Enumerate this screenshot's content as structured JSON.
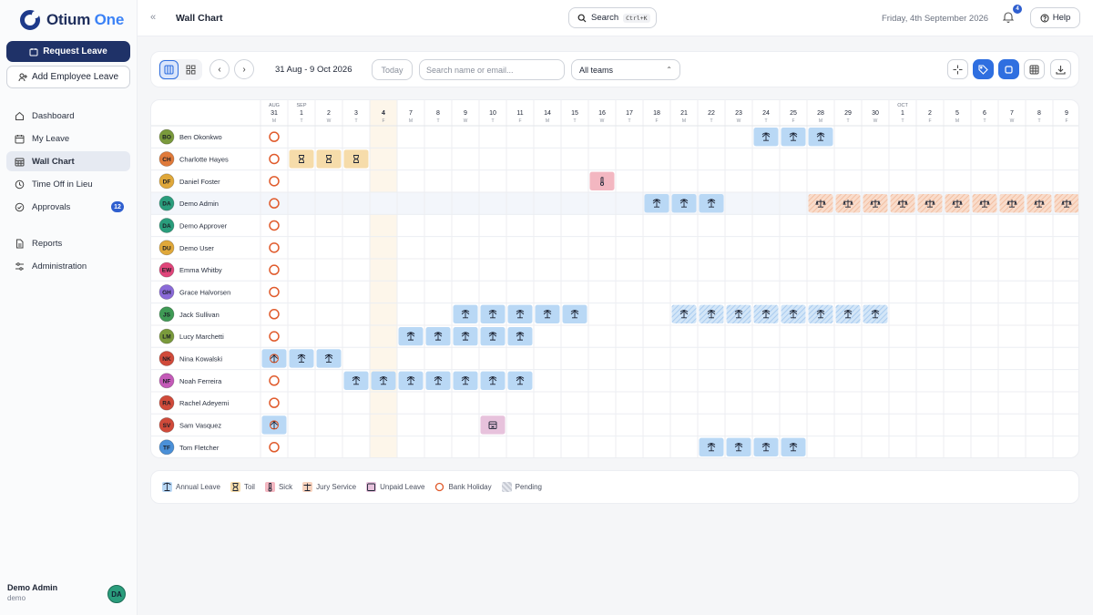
{
  "app": {
    "name_a": "Otium",
    "name_b": " One"
  },
  "sidebar": {
    "request_leave": "Request Leave",
    "add_employee_leave": "Add Employee Leave",
    "items": [
      {
        "label": "Dashboard",
        "icon": "home-icon"
      },
      {
        "label": "My Leave",
        "icon": "calendar-icon"
      },
      {
        "label": "Wall Chart",
        "icon": "calendar-grid-icon",
        "active": true
      },
      {
        "label": "Time Off in Lieu",
        "icon": "clock-icon"
      },
      {
        "label": "Approvals",
        "icon": "check-circle-icon",
        "badge": "12"
      },
      {
        "label": "Reports",
        "icon": "document-icon"
      },
      {
        "label": "Administration",
        "icon": "sliders-icon"
      }
    ],
    "user": {
      "name": "Demo Admin",
      "role": "demo",
      "initials": "DA"
    }
  },
  "topbar": {
    "title": "Wall Chart",
    "search_label": "Search",
    "search_shortcut": "Ctrl+K",
    "date": "Friday, 4th September 2026",
    "notifications": "4",
    "help": "Help"
  },
  "toolbar": {
    "range": "31 Aug - 9 Oct 2026",
    "today": "Today",
    "search_placeholder": "Search name or email...",
    "team": "All teams"
  },
  "days": [
    {
      "m": "AUG",
      "d": "31",
      "w": "M"
    },
    {
      "m": "SEP",
      "d": "1",
      "w": "T"
    },
    {
      "d": "2",
      "w": "W"
    },
    {
      "d": "3",
      "w": "T"
    },
    {
      "d": "4",
      "w": "F",
      "today": true
    },
    {
      "d": "7",
      "w": "M"
    },
    {
      "d": "8",
      "w": "T"
    },
    {
      "d": "9",
      "w": "W"
    },
    {
      "d": "10",
      "w": "T"
    },
    {
      "d": "11",
      "w": "F"
    },
    {
      "d": "14",
      "w": "M"
    },
    {
      "d": "15",
      "w": "T"
    },
    {
      "d": "16",
      "w": "W"
    },
    {
      "d": "17",
      "w": "T"
    },
    {
      "d": "18",
      "w": "F"
    },
    {
      "d": "21",
      "w": "M"
    },
    {
      "d": "22",
      "w": "T"
    },
    {
      "d": "23",
      "w": "W"
    },
    {
      "d": "24",
      "w": "T"
    },
    {
      "d": "25",
      "w": "F"
    },
    {
      "d": "28",
      "w": "M"
    },
    {
      "d": "29",
      "w": "T"
    },
    {
      "d": "30",
      "w": "W"
    },
    {
      "m": "OCT",
      "d": "1",
      "w": "T"
    },
    {
      "d": "2",
      "w": "F"
    },
    {
      "d": "5",
      "w": "M"
    },
    {
      "d": "6",
      "w": "T"
    },
    {
      "d": "7",
      "w": "W"
    },
    {
      "d": "8",
      "w": "T"
    },
    {
      "d": "9",
      "w": "F"
    }
  ],
  "employees": [
    {
      "initials": "BO",
      "name": "Ben Okonkwo",
      "color": "#7a9a3c",
      "leaves": [
        {
          "type": "annual",
          "days": [
            18,
            19,
            20
          ]
        }
      ]
    },
    {
      "initials": "CH",
      "name": "Charlotte Hayes",
      "color": "#e07a3a",
      "leaves": [
        {
          "type": "toil",
          "days": [
            1,
            2,
            3
          ]
        }
      ]
    },
    {
      "initials": "DF",
      "name": "Daniel Foster",
      "color": "#e0a83a",
      "leaves": [
        {
          "type": "sick",
          "days": [
            12
          ]
        }
      ]
    },
    {
      "initials": "DA",
      "name": "Demo Admin",
      "color": "#2a9d7c",
      "highlight": true,
      "leaves": [
        {
          "type": "annual",
          "days": [
            14,
            15,
            16
          ]
        },
        {
          "type": "jury",
          "days": [
            20,
            21,
            22,
            23,
            24,
            25,
            26,
            27,
            28,
            29
          ]
        }
      ]
    },
    {
      "initials": "DA",
      "name": "Demo Approver",
      "color": "#2a9d7c",
      "leaves": []
    },
    {
      "initials": "DU",
      "name": "Demo User",
      "color": "#e0a83a",
      "leaves": []
    },
    {
      "initials": "EW",
      "name": "Emma Whitby",
      "color": "#e0457a",
      "leaves": []
    },
    {
      "initials": "GH",
      "name": "Grace Halvorsen",
      "color": "#8a6ad8",
      "leaves": []
    },
    {
      "initials": "JS",
      "name": "Jack Sullivan",
      "color": "#3f9a55",
      "leaves": [
        {
          "type": "annual",
          "days": [
            7,
            8,
            9,
            10,
            11
          ]
        },
        {
          "type": "annual_pending",
          "days": [
            15,
            16,
            17,
            18,
            19,
            20,
            21,
            22
          ]
        }
      ]
    },
    {
      "initials": "LM",
      "name": "Lucy Marchetti",
      "color": "#7a9a3c",
      "leaves": [
        {
          "type": "annual",
          "days": [
            5,
            6,
            7,
            8,
            9
          ]
        }
      ]
    },
    {
      "initials": "NK",
      "name": "Nina Kowalski",
      "color": "#d04a3a",
      "leaves": [
        {
          "type": "annual",
          "days": [
            0,
            1,
            2
          ],
          "first_bank": true
        }
      ]
    },
    {
      "initials": "NF",
      "name": "Noah Ferreira",
      "color": "#c45ab8",
      "leaves": [
        {
          "type": "annual",
          "days": [
            3,
            4,
            5,
            6,
            7,
            8,
            9
          ]
        }
      ]
    },
    {
      "initials": "RA",
      "name": "Rachel Adeyemi",
      "color": "#d04a3a",
      "leaves": []
    },
    {
      "initials": "SV",
      "name": "Sam Vasquez",
      "color": "#d04a3a",
      "leaves": [
        {
          "type": "annual",
          "days": [
            0
          ],
          "first_bank": true
        },
        {
          "type": "unpaid",
          "days": [
            8
          ]
        }
      ]
    },
    {
      "initials": "TF",
      "name": "Tom Fletcher",
      "color": "#4a90d8",
      "leaves": [
        {
          "type": "annual",
          "days": [
            16,
            17,
            18,
            19
          ]
        }
      ]
    }
  ],
  "legend": [
    {
      "type": "annual",
      "label": "Annual Leave"
    },
    {
      "type": "toil",
      "label": "Toil"
    },
    {
      "type": "sick",
      "label": "Sick"
    },
    {
      "type": "jury",
      "label": "Jury Service"
    },
    {
      "type": "unpaid",
      "label": "Unpaid Leave"
    },
    {
      "type": "bank",
      "label": "Bank Holiday"
    },
    {
      "type": "pending",
      "label": "Pending"
    }
  ],
  "colors": {
    "annual": "#b9d8f5",
    "toil": "#f6dcaa",
    "sick": "#f3b7c1",
    "jury": "#f7d2bd",
    "unpaid": "#e7c2dc",
    "bank": "#e05a2b",
    "brand": "#1f3268",
    "accent": "#2f6fe0"
  }
}
